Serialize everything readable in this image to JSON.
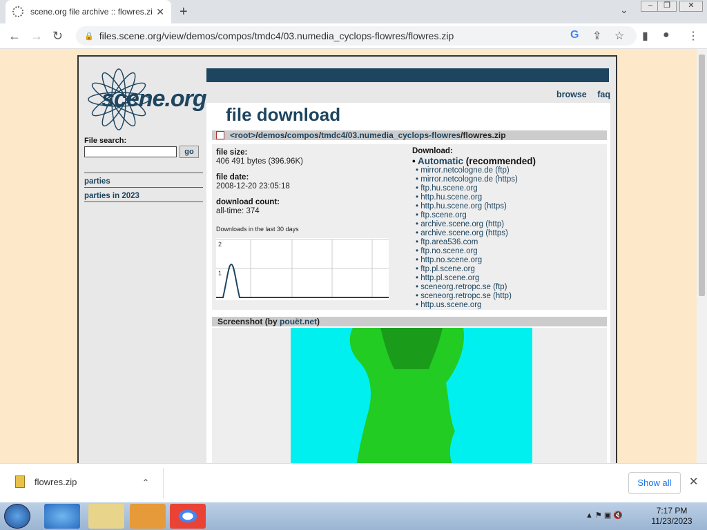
{
  "browser": {
    "tab_title": "scene.org file archive :: flowres.zi",
    "url": "files.scene.org/view/demos/compos/tmdc4/03.numedia_cyclops-flowres/flowres.zip"
  },
  "sidebar": {
    "logo_text": "scene.org",
    "file_search_label": "File search:",
    "go_label": "go",
    "links": [
      "parties",
      "parties in 2023"
    ]
  },
  "topnav": {
    "browse": "browse",
    "faq": "faq"
  },
  "page_title": "file download",
  "breadcrumb": {
    "root": "<root>",
    "parts": [
      "demos",
      "compos",
      "tmdc4",
      "03.numedia_cyclops-flowres"
    ],
    "file": "flowres.zip"
  },
  "info": {
    "file_size_label": "file size:",
    "file_size_value": "406 491 bytes (396.96K)",
    "file_date_label": "file date:",
    "file_date_value": "2008-12-20 23:05:18",
    "download_count_label": "download count:",
    "download_count_value": "all-time: 374",
    "graph_title": "Downloads in the last 30 days"
  },
  "chart_data": {
    "type": "line",
    "title": "Downloads in the last 30 days",
    "ylim": [
      0,
      2
    ],
    "yticks": [
      "2",
      "1"
    ],
    "note": "single peak near start, flat afterwards"
  },
  "download": {
    "label": "Download:",
    "auto_link": "Automatic",
    "auto_suffix": "(recommended)",
    "mirrors": [
      "mirror.netcologne.de (ftp)",
      "mirror.netcologne.de (https)",
      "ftp.hu.scene.org",
      "http.hu.scene.org",
      "http.hu.scene.org (https)",
      "ftp.scene.org",
      "archive.scene.org (http)",
      "archive.scene.org (https)",
      "ftp.area536.com",
      "ftp.no.scene.org",
      "http.no.scene.org",
      "ftp.pl.scene.org",
      "http.pl.scene.org",
      "sceneorg.retropc.se (ftp)",
      "sceneorg.retropc.se (http)",
      "http.us.scene.org"
    ]
  },
  "screenshot": {
    "label": "Screenshot (by ",
    "source": "pouët.net",
    "close": ")"
  },
  "downloads_bar": {
    "file": "flowres.zip",
    "show_all": "Show all"
  },
  "taskbar": {
    "time": "7:17 PM",
    "date": "11/23/2023"
  }
}
